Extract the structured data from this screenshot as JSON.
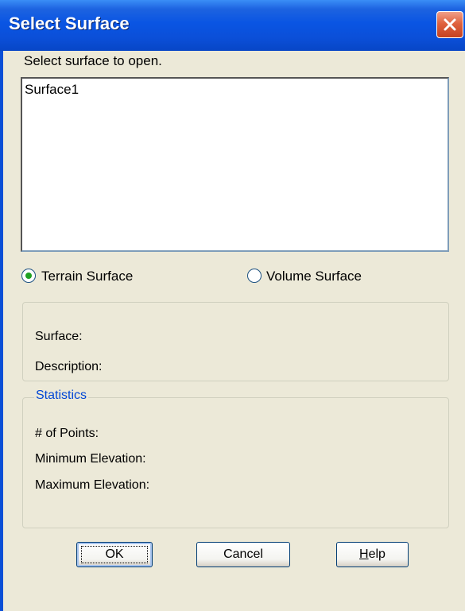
{
  "window": {
    "title": "Select Surface"
  },
  "prompt": "Select surface to open.",
  "surface_list": {
    "items": [
      "Surface1"
    ]
  },
  "surface_type": {
    "options": [
      {
        "label": "Terrain Surface",
        "selected": true
      },
      {
        "label": "Volume Surface",
        "selected": false
      }
    ]
  },
  "info": {
    "surface_label": "Surface:",
    "description_label": "Description:"
  },
  "statistics": {
    "title": "Statistics",
    "points_label": "# of Points:",
    "min_elev_label": "Minimum Elevation:",
    "max_elev_label": "Maximum Elevation:"
  },
  "buttons": {
    "ok": "OK",
    "cancel": "Cancel",
    "help_prefix": "H",
    "help_rest": "elp"
  },
  "colors": {
    "titlebar": "#0a55e3",
    "close": "#e0633f",
    "group_title": "#0046d5",
    "radio_dot": "#21a121"
  },
  "icons": {
    "close": "close-icon"
  }
}
